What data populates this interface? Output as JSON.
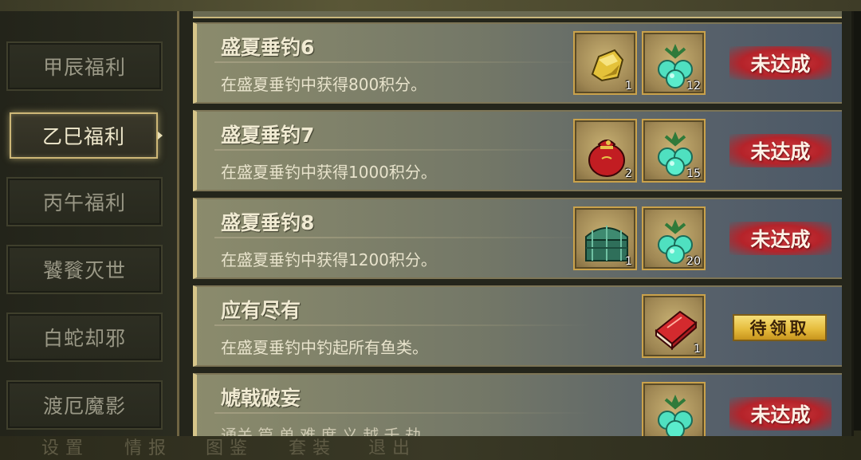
{
  "bottom_menu": [
    {
      "label": "设置"
    },
    {
      "label": "情报"
    },
    {
      "label": "图鉴"
    },
    {
      "label": "套装"
    },
    {
      "label": "退出"
    }
  ],
  "sidebar": {
    "items": [
      {
        "label": "甲辰福利",
        "active": false
      },
      {
        "label": "乙巳福利",
        "active": true
      },
      {
        "label": "丙午福利",
        "active": false
      },
      {
        "label": "饕餮灭世",
        "active": false
      },
      {
        "label": "白蛇却邪",
        "active": false
      },
      {
        "label": "渡厄魔影",
        "active": false
      }
    ]
  },
  "tasks": [
    {
      "title": "盛夏垂钓6",
      "desc": "在盛夏垂钓中获得800积分。",
      "rewards": [
        {
          "icon": "gold-ore-icon",
          "count": "1"
        },
        {
          "icon": "jade-fruit-icon",
          "count": "12"
        }
      ],
      "status": "未达成",
      "status_type": "not-achieved"
    },
    {
      "title": "盛夏垂钓7",
      "desc": "在盛夏垂钓中获得1000积分。",
      "rewards": [
        {
          "icon": "red-pouch-icon",
          "count": "2"
        },
        {
          "icon": "jade-fruit-icon",
          "count": "15"
        }
      ],
      "status": "未达成",
      "status_type": "not-achieved"
    },
    {
      "title": "盛夏垂钓8",
      "desc": "在盛夏垂钓中获得1200积分。",
      "rewards": [
        {
          "icon": "jade-chest-icon",
          "count": "1"
        },
        {
          "icon": "jade-fruit-icon",
          "count": "20"
        }
      ],
      "status": "未达成",
      "status_type": "not-achieved"
    },
    {
      "title": "应有尽有",
      "desc": "在盛夏垂钓中钓起所有鱼类。",
      "rewards": [
        {
          "icon": "red-book-icon",
          "count": "1"
        }
      ],
      "status": "待领取",
      "status_type": "claimable"
    },
    {
      "title": "虓戟破妄",
      "desc": "通关 篇 单 难 度 义 越 千 劫",
      "rewards": [
        {
          "icon": "jade-fruit-icon",
          "count": ""
        }
      ],
      "status": "未达成",
      "status_type": "not-achieved"
    }
  ],
  "colors": {
    "not_achieved_red": "#c0272d",
    "claim_gold": "#e6bd3e",
    "accent_gold": "#d6c58a"
  }
}
